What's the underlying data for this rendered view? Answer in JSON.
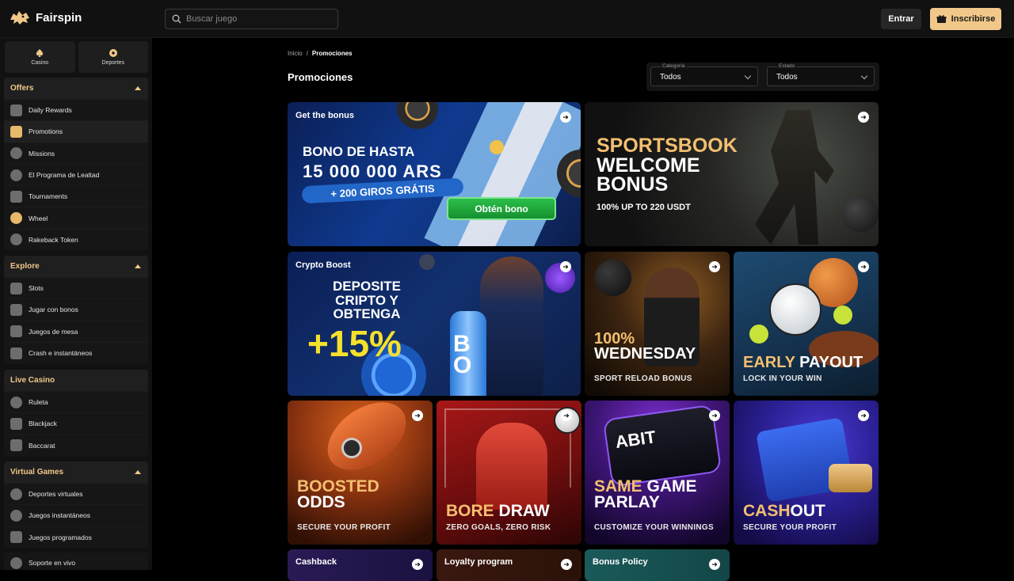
{
  "header": {
    "brand": "Fairspin",
    "search_placeholder": "Buscar juego",
    "login_label": "Entrar",
    "register_label": "Inscribirse"
  },
  "sidebar": {
    "tabs": [
      {
        "label": "Casino",
        "icon": "spade-icon"
      },
      {
        "label": "Deportes",
        "icon": "soccer-ball-icon"
      }
    ],
    "groups": [
      {
        "title": "Offers",
        "items": [
          {
            "label": "Daily Rewards",
            "icon": "calendar-icon"
          },
          {
            "label": "Promotions",
            "icon": "promotions-icon",
            "active": true
          },
          {
            "label": "Missions",
            "icon": "target-icon"
          },
          {
            "label": "El Programa de Lealtad",
            "icon": "medal-icon"
          },
          {
            "label": "Tournaments",
            "icon": "trophy-icon"
          },
          {
            "label": "Wheel",
            "icon": "wheel-icon"
          },
          {
            "label": "Rakeback Token",
            "icon": "token-icon"
          }
        ]
      },
      {
        "title": "Explore",
        "items": [
          {
            "label": "Slots",
            "icon": "slots-icon"
          },
          {
            "label": "Jugar con bonos",
            "icon": "gift-icon"
          },
          {
            "label": "Juegos de mesa",
            "icon": "cards-icon"
          },
          {
            "label": "Crash e instantáneos",
            "icon": "rocket-icon"
          }
        ]
      },
      {
        "title": "Live Casino",
        "items": [
          {
            "label": "Ruleta",
            "icon": "roulette-icon"
          },
          {
            "label": "Blackjack",
            "icon": "blackjack-icon"
          },
          {
            "label": "Baccarat",
            "icon": "baccarat-icon"
          }
        ]
      },
      {
        "title": "Virtual Games",
        "items": [
          {
            "label": "Deportes virtuales",
            "icon": "virtual-sports-icon"
          },
          {
            "label": "Juegos instantáneos",
            "icon": "instant-games-icon"
          },
          {
            "label": "Juegos programados",
            "icon": "scheduled-games-icon"
          }
        ]
      }
    ],
    "support_label": "Soporte en vivo"
  },
  "main": {
    "breadcrumb": {
      "home": "Inicio",
      "separator": "/",
      "current": "Promociones"
    },
    "title": "Promociones",
    "filters": [
      {
        "label": "Categoría",
        "value": "Todos"
      },
      {
        "label": "Estado",
        "value": "Todos"
      }
    ],
    "promos": {
      "bonus": {
        "label": "Get the bonus",
        "line1": "BONO DE HASTA",
        "line2": "15 000 000 ARS",
        "line3": "+ 200 GIROS GRÁTIS",
        "cta": "Obtén bono"
      },
      "sportsbook": {
        "line1": "SPORTSBOOK",
        "line2": "WELCOME",
        "line3": "BONUS",
        "sub": "100% UP TO 220 USDT"
      },
      "crypto": {
        "label": "Crypto Boost",
        "line1": "DEPOSITE",
        "line2": "CRIPTO Y",
        "line3": "OBTENGA",
        "big": "+15%",
        "bottle": "BO"
      },
      "wednesday": {
        "gold": "100%",
        "white": "WEDNESDAY",
        "sub": "SPORT RELOAD BONUS"
      },
      "early": {
        "gold": "EARLY",
        "white": "PAYOUT",
        "sub": "LOCK IN YOUR WIN"
      },
      "boosted": {
        "gold": "BOOSTED",
        "white": "ODDS",
        "sub": "SECURE YOUR PROFIT"
      },
      "bore": {
        "gold": "BORE",
        "white": "DRAW",
        "sub": "ZERO GOALS, ZERO RISK"
      },
      "parlay": {
        "gold": "SAME",
        "white_a": "GAME",
        "white_b": "PARLAY",
        "sub": "CUSTOMIZE YOUR WINNINGS",
        "screen": "ABIT"
      },
      "cashout": {
        "gold": "CASH",
        "white": "OUT",
        "sub": "SECURE YOUR PROFIT"
      },
      "cashback": {
        "label": "Cashback"
      },
      "loyalty": {
        "label": "Loyalty program"
      },
      "policy": {
        "label": "Bonus Policy"
      }
    }
  },
  "colors": {
    "accent": "#f1c889",
    "gold_text": "#f3bf70",
    "background": "#000000",
    "panel": "#111111"
  }
}
